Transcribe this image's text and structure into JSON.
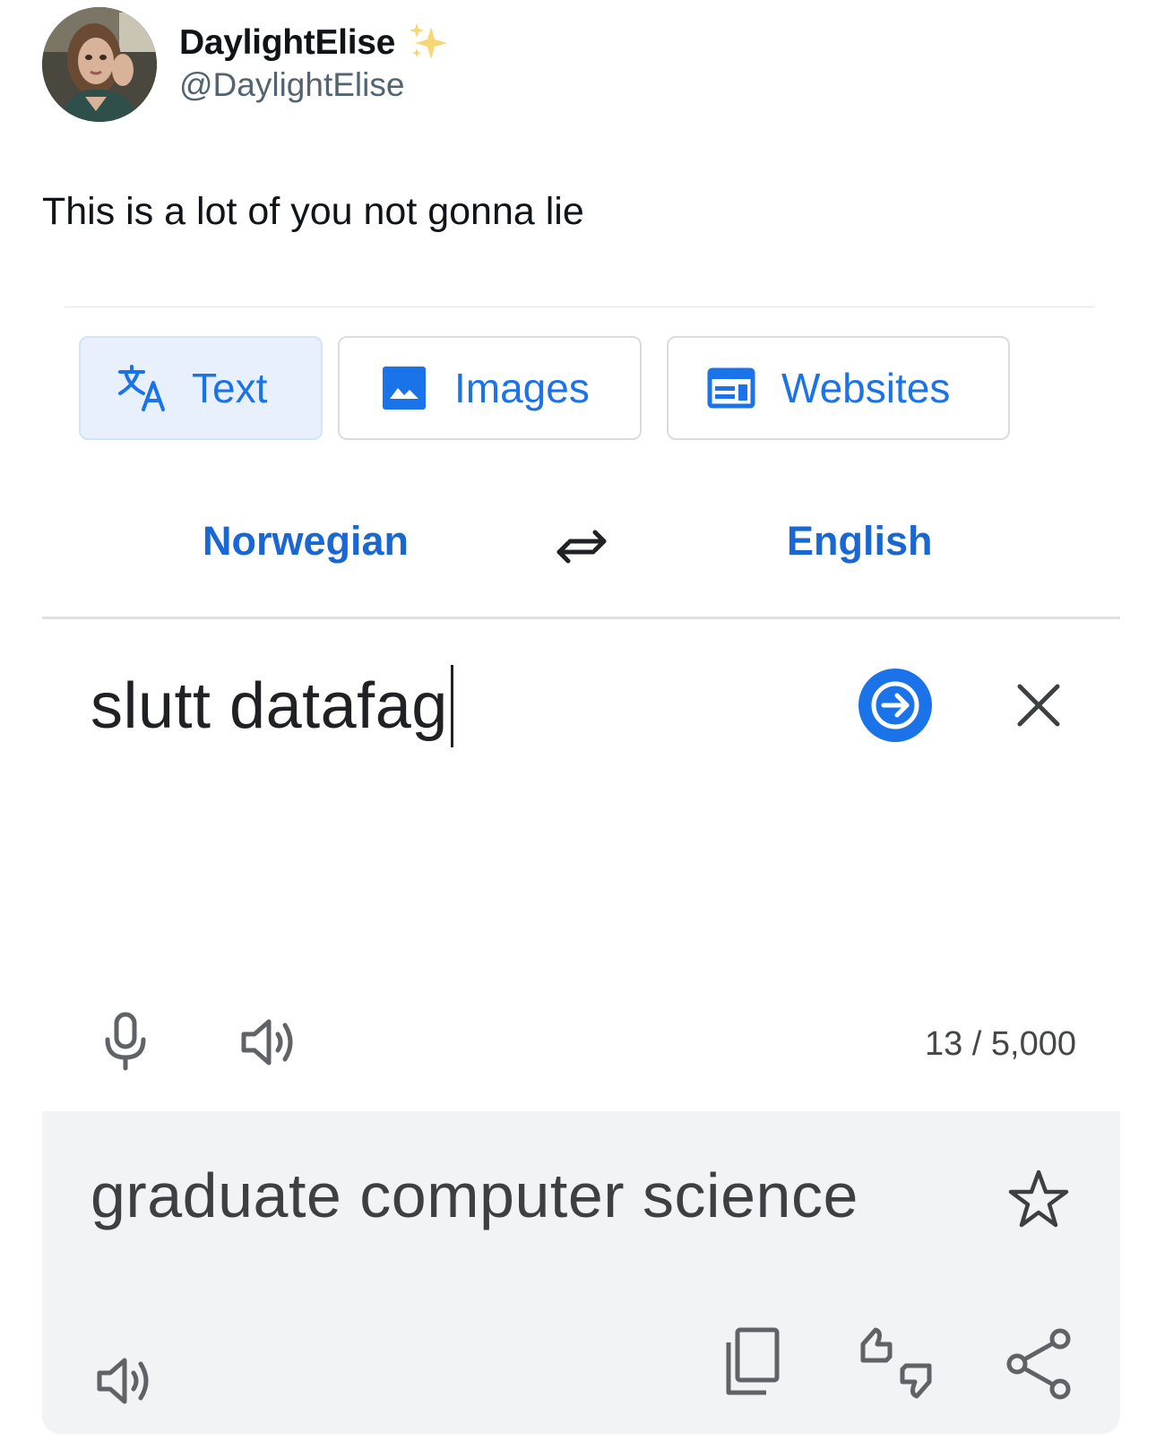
{
  "tweet": {
    "display_name": "DaylightElise",
    "handle": "@DaylightElise",
    "text": "This is a lot of you not gonna lie",
    "name_emoji": "sparkles-icon"
  },
  "translate": {
    "tabs": [
      {
        "label": "Text",
        "icon": "translate-icon",
        "active": true
      },
      {
        "label": "Images",
        "icon": "image-icon",
        "active": false
      },
      {
        "label": "Websites",
        "icon": "web-icon",
        "active": false
      }
    ],
    "source_language": "Norwegian",
    "target_language": "English",
    "source_text": "slutt datafag",
    "char_count": "13 / 5,000",
    "result_text": "graduate computer science",
    "colors": {
      "accent": "#1a73e8",
      "language_label": "#1967d2",
      "active_tab_bg": "#e8f0fe",
      "result_panel_bg": "#f1f3f4",
      "icon_gray": "#5f6368"
    }
  }
}
